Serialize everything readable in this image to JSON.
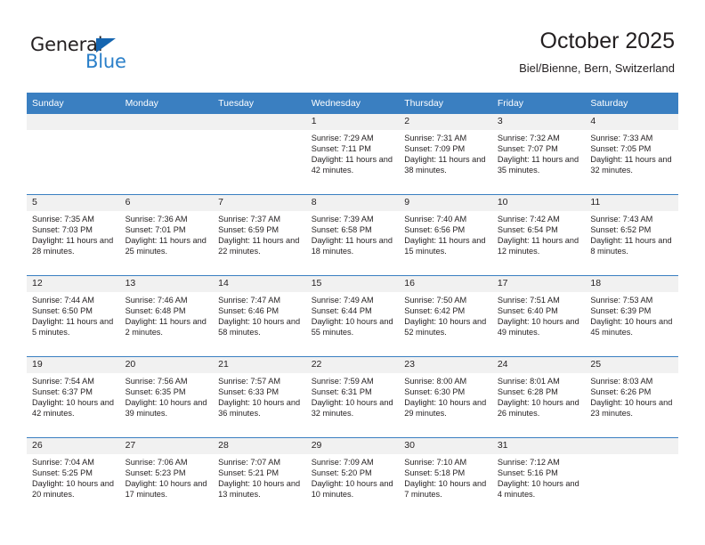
{
  "brand": {
    "name_dark": "General",
    "name_blue": "Blue",
    "accent_color": "#2a7fc9",
    "triangle_color": "#1565b0"
  },
  "header": {
    "title": "October 2025",
    "subtitle": "Biel/Bienne, Bern, Switzerland"
  },
  "calendar": {
    "header_bg": "#3a7fc1",
    "daynum_bg": "#f1f1f1",
    "weekday_headers": [
      "Sunday",
      "Monday",
      "Tuesday",
      "Wednesday",
      "Thursday",
      "Friday",
      "Saturday"
    ],
    "weeks": [
      [
        {
          "day": "",
          "empty": true
        },
        {
          "day": "",
          "empty": true
        },
        {
          "day": "",
          "empty": true
        },
        {
          "day": "1",
          "sunrise": "Sunrise: 7:29 AM",
          "sunset": "Sunset: 7:11 PM",
          "daylight": "Daylight: 11 hours and 42 minutes."
        },
        {
          "day": "2",
          "sunrise": "Sunrise: 7:31 AM",
          "sunset": "Sunset: 7:09 PM",
          "daylight": "Daylight: 11 hours and 38 minutes."
        },
        {
          "day": "3",
          "sunrise": "Sunrise: 7:32 AM",
          "sunset": "Sunset: 7:07 PM",
          "daylight": "Daylight: 11 hours and 35 minutes."
        },
        {
          "day": "4",
          "sunrise": "Sunrise: 7:33 AM",
          "sunset": "Sunset: 7:05 PM",
          "daylight": "Daylight: 11 hours and 32 minutes."
        }
      ],
      [
        {
          "day": "5",
          "sunrise": "Sunrise: 7:35 AM",
          "sunset": "Sunset: 7:03 PM",
          "daylight": "Daylight: 11 hours and 28 minutes."
        },
        {
          "day": "6",
          "sunrise": "Sunrise: 7:36 AM",
          "sunset": "Sunset: 7:01 PM",
          "daylight": "Daylight: 11 hours and 25 minutes."
        },
        {
          "day": "7",
          "sunrise": "Sunrise: 7:37 AM",
          "sunset": "Sunset: 6:59 PM",
          "daylight": "Daylight: 11 hours and 22 minutes."
        },
        {
          "day": "8",
          "sunrise": "Sunrise: 7:39 AM",
          "sunset": "Sunset: 6:58 PM",
          "daylight": "Daylight: 11 hours and 18 minutes."
        },
        {
          "day": "9",
          "sunrise": "Sunrise: 7:40 AM",
          "sunset": "Sunset: 6:56 PM",
          "daylight": "Daylight: 11 hours and 15 minutes."
        },
        {
          "day": "10",
          "sunrise": "Sunrise: 7:42 AM",
          "sunset": "Sunset: 6:54 PM",
          "daylight": "Daylight: 11 hours and 12 minutes."
        },
        {
          "day": "11",
          "sunrise": "Sunrise: 7:43 AM",
          "sunset": "Sunset: 6:52 PM",
          "daylight": "Daylight: 11 hours and 8 minutes."
        }
      ],
      [
        {
          "day": "12",
          "sunrise": "Sunrise: 7:44 AM",
          "sunset": "Sunset: 6:50 PM",
          "daylight": "Daylight: 11 hours and 5 minutes."
        },
        {
          "day": "13",
          "sunrise": "Sunrise: 7:46 AM",
          "sunset": "Sunset: 6:48 PM",
          "daylight": "Daylight: 11 hours and 2 minutes."
        },
        {
          "day": "14",
          "sunrise": "Sunrise: 7:47 AM",
          "sunset": "Sunset: 6:46 PM",
          "daylight": "Daylight: 10 hours and 58 minutes."
        },
        {
          "day": "15",
          "sunrise": "Sunrise: 7:49 AM",
          "sunset": "Sunset: 6:44 PM",
          "daylight": "Daylight: 10 hours and 55 minutes."
        },
        {
          "day": "16",
          "sunrise": "Sunrise: 7:50 AM",
          "sunset": "Sunset: 6:42 PM",
          "daylight": "Daylight: 10 hours and 52 minutes."
        },
        {
          "day": "17",
          "sunrise": "Sunrise: 7:51 AM",
          "sunset": "Sunset: 6:40 PM",
          "daylight": "Daylight: 10 hours and 49 minutes."
        },
        {
          "day": "18",
          "sunrise": "Sunrise: 7:53 AM",
          "sunset": "Sunset: 6:39 PM",
          "daylight": "Daylight: 10 hours and 45 minutes."
        }
      ],
      [
        {
          "day": "19",
          "sunrise": "Sunrise: 7:54 AM",
          "sunset": "Sunset: 6:37 PM",
          "daylight": "Daylight: 10 hours and 42 minutes."
        },
        {
          "day": "20",
          "sunrise": "Sunrise: 7:56 AM",
          "sunset": "Sunset: 6:35 PM",
          "daylight": "Daylight: 10 hours and 39 minutes."
        },
        {
          "day": "21",
          "sunrise": "Sunrise: 7:57 AM",
          "sunset": "Sunset: 6:33 PM",
          "daylight": "Daylight: 10 hours and 36 minutes."
        },
        {
          "day": "22",
          "sunrise": "Sunrise: 7:59 AM",
          "sunset": "Sunset: 6:31 PM",
          "daylight": "Daylight: 10 hours and 32 minutes."
        },
        {
          "day": "23",
          "sunrise": "Sunrise: 8:00 AM",
          "sunset": "Sunset: 6:30 PM",
          "daylight": "Daylight: 10 hours and 29 minutes."
        },
        {
          "day": "24",
          "sunrise": "Sunrise: 8:01 AM",
          "sunset": "Sunset: 6:28 PM",
          "daylight": "Daylight: 10 hours and 26 minutes."
        },
        {
          "day": "25",
          "sunrise": "Sunrise: 8:03 AM",
          "sunset": "Sunset: 6:26 PM",
          "daylight": "Daylight: 10 hours and 23 minutes."
        }
      ],
      [
        {
          "day": "26",
          "sunrise": "Sunrise: 7:04 AM",
          "sunset": "Sunset: 5:25 PM",
          "daylight": "Daylight: 10 hours and 20 minutes."
        },
        {
          "day": "27",
          "sunrise": "Sunrise: 7:06 AM",
          "sunset": "Sunset: 5:23 PM",
          "daylight": "Daylight: 10 hours and 17 minutes."
        },
        {
          "day": "28",
          "sunrise": "Sunrise: 7:07 AM",
          "sunset": "Sunset: 5:21 PM",
          "daylight": "Daylight: 10 hours and 13 minutes."
        },
        {
          "day": "29",
          "sunrise": "Sunrise: 7:09 AM",
          "sunset": "Sunset: 5:20 PM",
          "daylight": "Daylight: 10 hours and 10 minutes."
        },
        {
          "day": "30",
          "sunrise": "Sunrise: 7:10 AM",
          "sunset": "Sunset: 5:18 PM",
          "daylight": "Daylight: 10 hours and 7 minutes."
        },
        {
          "day": "31",
          "sunrise": "Sunrise: 7:12 AM",
          "sunset": "Sunset: 5:16 PM",
          "daylight": "Daylight: 10 hours and 4 minutes."
        },
        {
          "day": "",
          "empty": true
        }
      ]
    ]
  }
}
